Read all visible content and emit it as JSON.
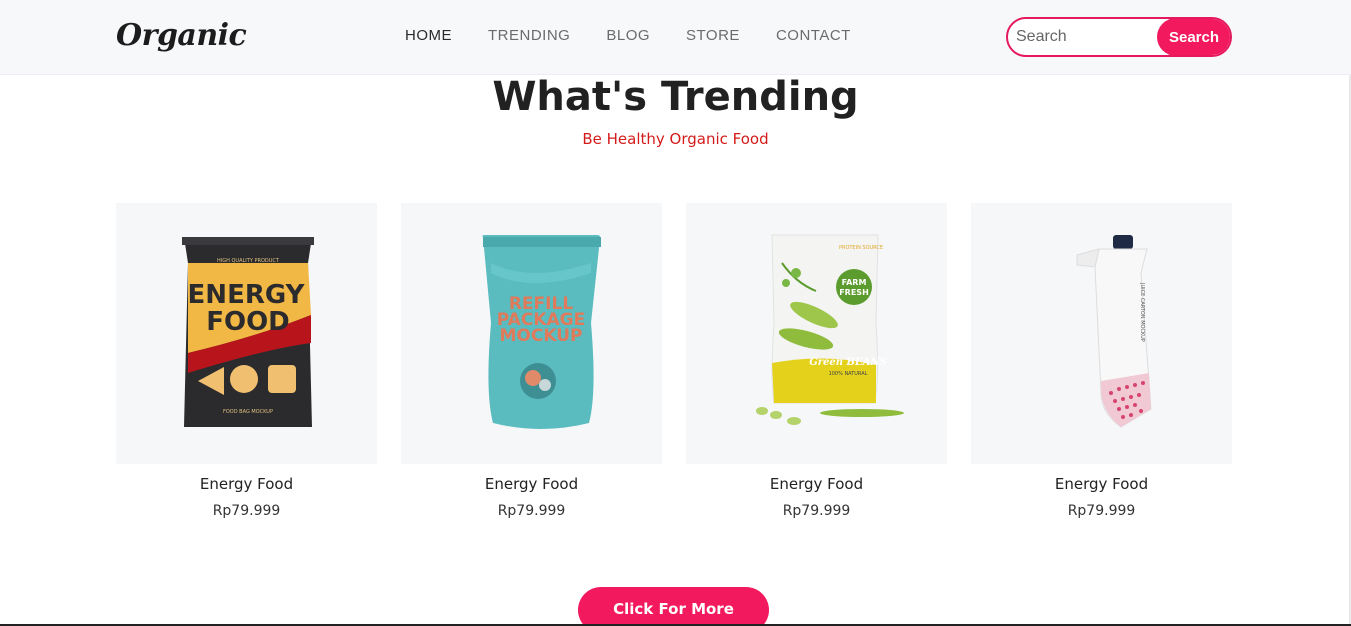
{
  "brand": "Organic",
  "nav": [
    {
      "label": "HOME"
    },
    {
      "label": "TRENDING"
    },
    {
      "label": "BLOG"
    },
    {
      "label": "STORE"
    },
    {
      "label": "CONTACT"
    }
  ],
  "search": {
    "placeholder": "Search",
    "button_label": "Search"
  },
  "section": {
    "title": "What's Trending",
    "subtitle": "Be Healthy Organic Food"
  },
  "products": [
    {
      "name": "Energy Food",
      "price": "Rp79.999",
      "image": "energy-food-bag",
      "bag_text_1": "ENERGY",
      "bag_text_2": "FOOD",
      "bag_top": "HIGH QUALITY PRODUCT",
      "bag_bottom": "FOOD BAG MOCKUP"
    },
    {
      "name": "Energy Food",
      "price": "Rp79.999",
      "image": "refill-pouch",
      "bag_text_1": "REFILL",
      "bag_text_2": "PACKAGE",
      "bag_text_3": "MOCKUP"
    },
    {
      "name": "Energy Food",
      "price": "Rp79.999",
      "image": "green-beans-pouch",
      "bag_text_1": "FARM",
      "bag_text_2": "FRESH",
      "bag_text_3": "Green BEANS",
      "bag_top": "PROTEIN SOURCE",
      "bag_bottom": "100% NATURAL"
    },
    {
      "name": "Energy Food",
      "price": "Rp79.999",
      "image": "juice-carton",
      "bag_text_1": "JUICE CARTON MOCKUP"
    }
  ],
  "more_button": "Click For More",
  "colors": {
    "accent": "#f2195f",
    "subtitle": "#d41b1b",
    "nav_bg": "#f7f8fa",
    "card_bg": "#f6f7f9"
  }
}
